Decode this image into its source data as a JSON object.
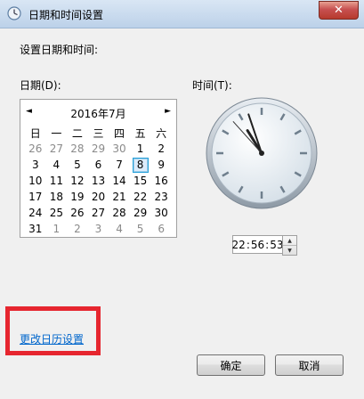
{
  "window": {
    "title": "日期和时间设置",
    "close_glyph": "✕"
  },
  "heading": "设置日期和时间:",
  "date_label": "日期(D):",
  "time_label": "时间(T):",
  "calendar": {
    "prev_glyph": "◄",
    "next_glyph": "►",
    "month_label": "2016年7月",
    "weekdays": [
      "日",
      "一",
      "二",
      "三",
      "四",
      "五",
      "六"
    ],
    "weeks": [
      [
        "26",
        "27",
        "28",
        "29",
        "30",
        "1",
        "2"
      ],
      [
        "3",
        "4",
        "5",
        "6",
        "7",
        "8",
        "9"
      ],
      [
        "10",
        "11",
        "12",
        "13",
        "14",
        "15",
        "16"
      ],
      [
        "17",
        "18",
        "19",
        "20",
        "21",
        "22",
        "23"
      ],
      [
        "24",
        "25",
        "26",
        "27",
        "28",
        "29",
        "30"
      ],
      [
        "31",
        "1",
        "2",
        "3",
        "4",
        "5",
        "6"
      ]
    ]
  },
  "time": {
    "hours": "22",
    "minutes": "56",
    "seconds": "53",
    "separator": ":"
  },
  "spinner": {
    "up_glyph": "▲",
    "down_glyph": "▼"
  },
  "link_text": "更改日历设置",
  "buttons": {
    "ok": "确定",
    "cancel": "取消"
  },
  "colors": {
    "link": "#0066cc",
    "highlight": "#e6262f",
    "selection": "#26a0da"
  }
}
